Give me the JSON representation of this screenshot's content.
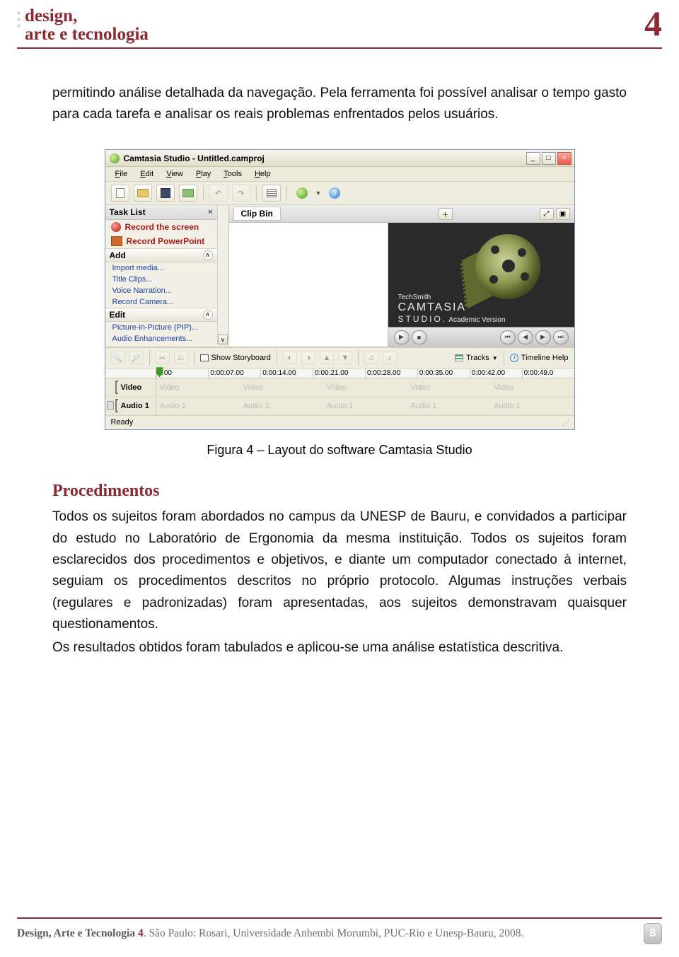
{
  "header": {
    "brand_line1": "design,",
    "brand_line2": "arte e tecnologia",
    "page_number_top": "4"
  },
  "intro_paragraph": "permitindo análise detalhada da navegação. Pela ferramenta foi possível analisar o tempo gasto para cada tarefa e analisar os reais problemas enfrentados pelos usuários.",
  "figure_caption": "Figura 4 – Layout do software Camtasia Studio",
  "section_heading": "Procedimentos",
  "section_para1": "Todos os sujeitos foram abordados no campus da UNESP de Bauru, e convidados a participar do estudo no Laboratório de Ergonomia da mesma instituição. Todos os sujeitos foram esclarecidos dos procedimentos e objetivos, e diante um computador conectado à internet, seguiam os procedimentos descritos no próprio protocolo. Algumas instruções verbais (regulares e padronizadas) foram apresentadas, aos sujeitos demonstravam quaisquer questionamentos.",
  "section_para2": "Os resultados obtidos foram tabulados e aplicou-se uma análise estatística descritiva.",
  "app": {
    "title": "Camtasia Studio - Untitled.camproj",
    "menus": [
      "File",
      "Edit",
      "View",
      "Play",
      "Tools",
      "Help"
    ],
    "task_list_title": "Task List",
    "task_items": [
      "Record the screen",
      "Record PowerPoint"
    ],
    "add_label": "Add",
    "add_items": [
      "Import media...",
      "Title Clips...",
      "Voice Narration...",
      "Record Camera..."
    ],
    "edit_label": "Edit",
    "edit_items": [
      "Picture-in-Picture (PIP)...",
      "Audio Enhancements..."
    ],
    "clip_bin_label": "Clip Bin",
    "preview_brand_small": "TechSmith",
    "preview_brand_line1": "CAMTASIA",
    "preview_brand_line2": "STUDIO.",
    "preview_brand_sub": "Academic Version",
    "show_storyboard": "Show Storyboard",
    "tracks_label": "Tracks",
    "timeline_help": "Timeline Help",
    "ruler_ticks": [
      "0.00",
      "0:00:07.00",
      "0:00:14.00",
      "0:00:21.00",
      "0:00:28.00",
      "0:00:35.00",
      "0:00:42.00",
      "0:00:49.0"
    ],
    "track_video": "Video",
    "track_audio": "Audio 1",
    "video_cells": [
      "Video",
      "Video",
      "Video",
      "Video",
      "Video"
    ],
    "audio_cells": [
      "Audio 1",
      "Audio 1",
      "Audio 1",
      "Audio 1",
      "Audio 1"
    ],
    "status": "Ready"
  },
  "footer": {
    "text_bold": "Design, Arte e Tecnologia ",
    "text_four": "4",
    "text_rest": ". São Paulo: Rosari, Universidade Anhembi Morumbi, PUC-Rio e Unesp-Bauru, 2008.",
    "badge": "8"
  }
}
